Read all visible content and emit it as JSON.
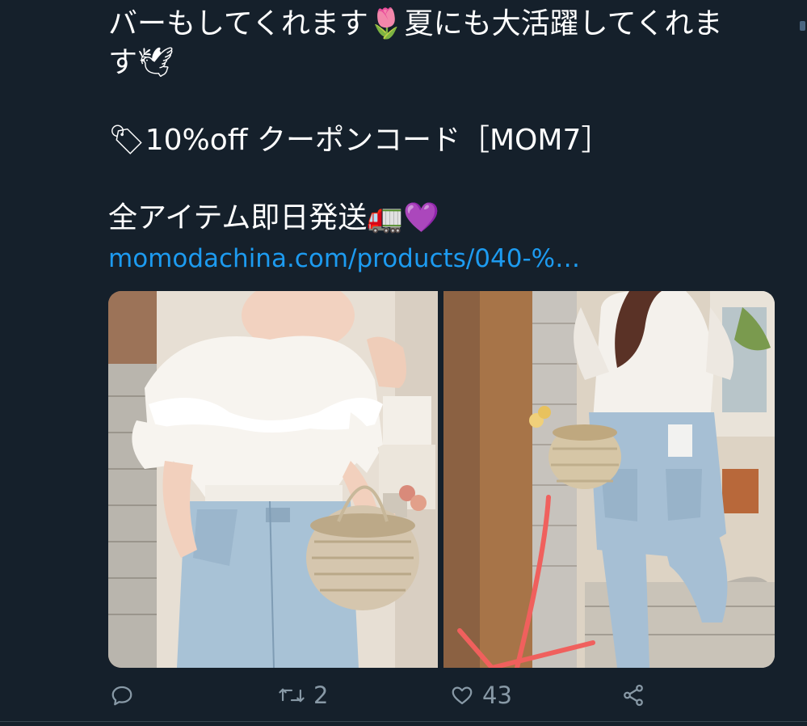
{
  "tweet": {
    "line1": "バーもしてくれます🌷夏にも大活躍してくれま",
    "line2": "す🕊",
    "line3": "🏷10%off クーポンコード［MOM7］",
    "line4": "全アイテム即日発送🚛💜",
    "link": "momodachina.com/products/040-%…"
  },
  "actions": {
    "reply_icon": "comment-icon",
    "retweet_icon": "retweet-icon",
    "retweet_count": "2",
    "like_icon": "heart-icon",
    "like_count": "43",
    "share_icon": "share-icon"
  },
  "colors": {
    "background": "#15202b",
    "text": "#ffffff",
    "link": "#1d9bf0",
    "muted": "#8899a6",
    "annotation_arrow": "#f0605d"
  }
}
